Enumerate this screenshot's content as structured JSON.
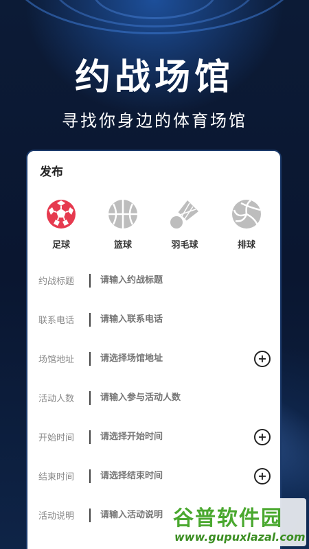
{
  "hero": {
    "title": "约战场馆",
    "subtitle": "寻找你身边的体育场馆"
  },
  "card": {
    "title": "发布",
    "sports": [
      {
        "label": "足球",
        "icon": "football-icon"
      },
      {
        "label": "篮球",
        "icon": "basketball-icon"
      },
      {
        "label": "羽毛球",
        "icon": "badminton-icon"
      },
      {
        "label": "排球",
        "icon": "volleyball-icon"
      }
    ],
    "form": [
      {
        "label": "约战标题",
        "placeholder": "请输入约战标题"
      },
      {
        "label": "联系电话",
        "placeholder": "请输入联系电话"
      },
      {
        "label": "场馆地址",
        "placeholder": "请选择场馆地址",
        "has_plus": true
      },
      {
        "label": "活动人数",
        "placeholder": "请输入参与活动人数"
      },
      {
        "label": "开始时间",
        "placeholder": "请选择开始时间",
        "has_plus": true
      },
      {
        "label": "结束时间",
        "placeholder": "请选择结束时间",
        "has_plus": true
      },
      {
        "label": "活动说明",
        "placeholder": "请输入活动说明"
      }
    ],
    "plus_symbol": "+"
  },
  "watermark": {
    "name": "谷普软件园",
    "url": "www.gupuxlazal.com"
  },
  "colors": {
    "background": "#0b1a33",
    "football": "#e63a4f",
    "icon_gray": "#bdbdbd",
    "watermark_green": "#4aa82f"
  }
}
